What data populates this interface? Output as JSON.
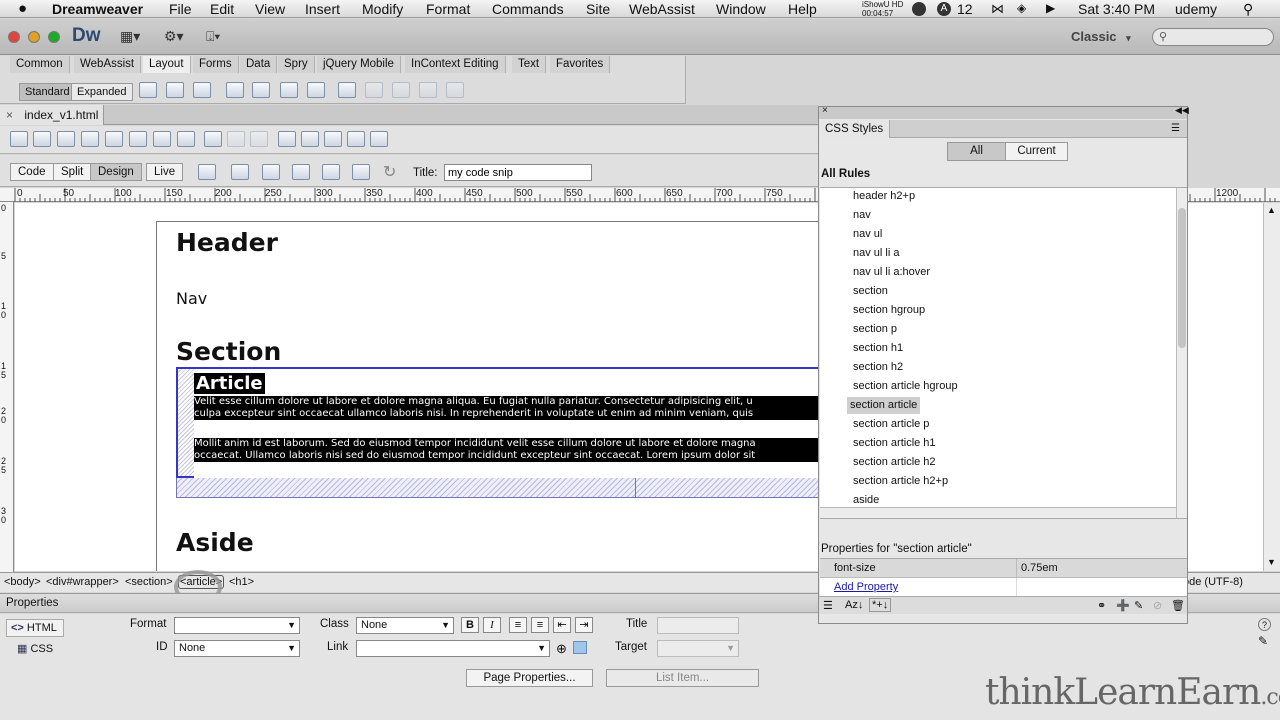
{
  "menubar": {
    "apple": "",
    "app": "Dreamweaver",
    "items": [
      "File",
      "Edit",
      "View",
      "Insert",
      "Modify",
      "Format",
      "Commands",
      "Site",
      "WebAssist",
      "Window",
      "Help"
    ],
    "ishowu": "iShowU HD",
    "ishowu_time": "00:04:57",
    "badge_count": "12",
    "clock": "Sat 3:40 PM",
    "user": "udemy"
  },
  "appbar": {
    "logo": "Dw",
    "workspace": "Classic",
    "workspace_arrow": "▾"
  },
  "insert_bar": {
    "tabs": [
      "Common",
      "WebAssist",
      "Layout",
      "Forms",
      "Data",
      "Spry",
      "jQuery Mobile",
      "InContext Editing",
      "Text",
      "Favorites"
    ],
    "active_tab": "Layout",
    "modes": [
      "Standard",
      "Expanded"
    ]
  },
  "document": {
    "tab_name": "index_v1.html",
    "close": "×",
    "view_buttons": [
      "Code",
      "Split",
      "Design",
      "Live"
    ],
    "active_view": "Design",
    "title_label": "Title:",
    "title_value": "my code snip"
  },
  "ruler": {
    "ticks": [
      "0",
      "50",
      "100",
      "150",
      "200",
      "250",
      "300",
      "350",
      "400",
      "450",
      "500",
      "550",
      "600",
      "650",
      "700",
      "750",
      "1200"
    ],
    "left_ticks": [
      "0",
      "5",
      "1",
      "0",
      "1",
      "5",
      "2",
      "0",
      "2",
      "5",
      "3",
      "0"
    ]
  },
  "design": {
    "header": "Header",
    "nav": "Nav",
    "section": "Section",
    "article_title": "Article",
    "para1_line1": "Velit esse cillum dolore ut labore et dolore magna aliqua. Eu fugiat nulla pariatur. Consectetur adipisicing elit, u",
    "para1_line2": "culpa excepteur sint occaecat ullamco laboris nisi. In reprehenderit in voluptate ut enim ad minim veniam, quis",
    "para2_line1": "Mollit anim id est laborum. Sed do eiusmod tempor incididunt velit esse cillum dolore ut labore et dolore magna",
    "para2_line2": "occaecat. Ullamco laboris nisi sed do eiusmod tempor incididunt excepteur sint occaecat. Lorem ipsum dolor sit",
    "aside": "Aside"
  },
  "status": {
    "tags": [
      "<body>",
      "<div#wrapper>",
      "<section>",
      "<article>",
      "<h1>"
    ],
    "encoding": "ode (UTF-8)"
  },
  "properties": {
    "title": "Properties",
    "html_label": "HTML",
    "css_label": "CSS",
    "format_label": "Format",
    "format_value": "",
    "class_label": "Class",
    "class_value": "None",
    "id_label": "ID",
    "id_value": "None",
    "link_label": "Link",
    "title_label": "Title",
    "target_label": "Target",
    "bold": "B",
    "italic": "I",
    "page_properties": "Page Properties...",
    "list_item": "List Item..."
  },
  "css_panel": {
    "tab": "CSS Styles",
    "toggle_all": "All",
    "toggle_current": "Current",
    "all_rules_label": "All Rules",
    "rules": [
      "header h2+p",
      "nav",
      "nav ul",
      "nav ul li a",
      "nav ul li a:hover",
      "section",
      "section hgroup",
      "section p",
      "section h1",
      "section h2",
      "section article",
      "section article p",
      "section article h1",
      "section article h2",
      "section article h2+p",
      "aside",
      "aside"
    ],
    "selected_rule": "section article",
    "properties_for": "Properties for \"section article\"",
    "prop_name": "font-size",
    "prop_value": "0.75em",
    "add_property": "Add Property",
    "footer_sort": "Az↓",
    "footer_star": "*+↓"
  },
  "watermark": {
    "text": "thinkLearnEarn",
    "suffix": ".com"
  },
  "colors": {
    "selection_border": "#3535c8",
    "link": "#1a1aa8",
    "selected_text_bg": "#000000"
  }
}
